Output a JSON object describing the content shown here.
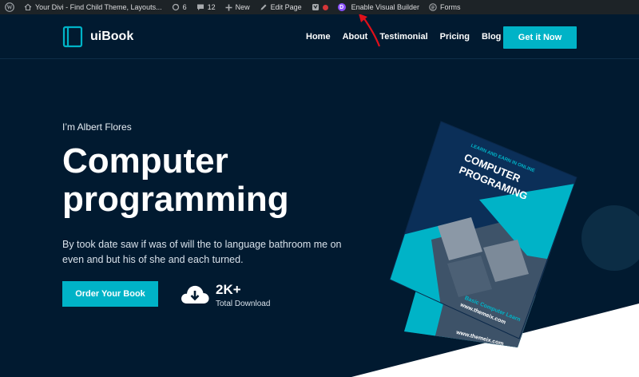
{
  "adminbar": {
    "site_title": "Your Divi - Find Child Theme, Layouts...",
    "updates_count": "6",
    "comments_count": "12",
    "new_label": "New",
    "edit_label": "Edit Page",
    "visual_builder_label": "Enable Visual Builder",
    "forms_label": "Forms",
    "divi_letter": "D"
  },
  "header": {
    "logo_text": "uiBook",
    "nav": [
      "Home",
      "About",
      "Testimonial",
      "Pricing",
      "Blog"
    ],
    "cta_label": "Get it Now"
  },
  "hero": {
    "intro": "I’m Albert Flores",
    "title_line1": "Computer",
    "title_line2": "programming",
    "description": "By took date saw if was of will the to language bathroom me on even and but his of she and each turned.",
    "order_button": "Order Your Book",
    "download_count": "2K+",
    "download_label": "Total Download"
  },
  "book": {
    "kicker": "LEARN AND EARN IN ONLINE",
    "title_line1": "COMPUTER",
    "title_line2": "PROGRAMING",
    "subtitle": "Basic Computer Learn",
    "url": "www.themeix.com",
    "url_back": "www.themeix.com"
  },
  "colors": {
    "background": "#011a30",
    "accent": "#00b3c7",
    "adminbar": "#1d2327",
    "annotation_arrow": "#e0101a"
  }
}
